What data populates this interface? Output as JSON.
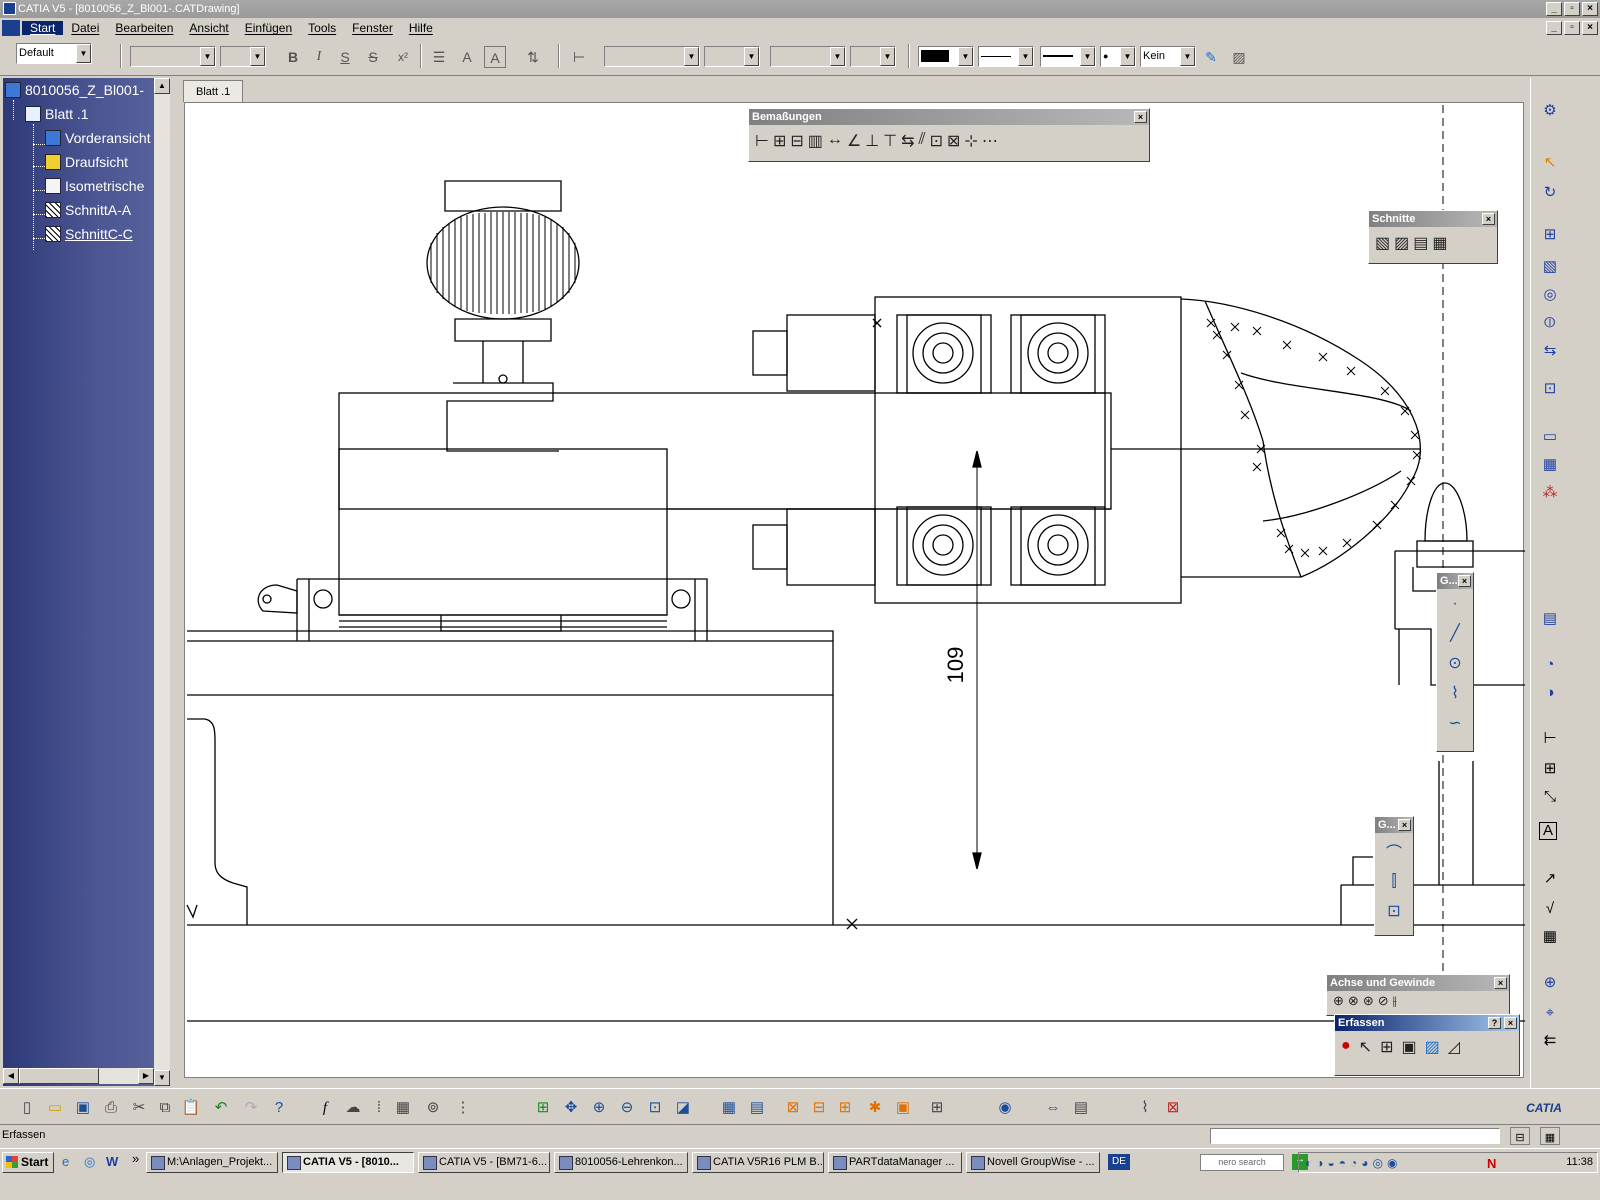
{
  "window": {
    "title": "CATIA V5 - [8010056_Z_Bl001-.CATDrawing]",
    "controls": [
      "_",
      "▫",
      "×"
    ]
  },
  "menu": {
    "items": [
      "Start",
      "Datei",
      "Bearbeiten",
      "Ansicht",
      "Einfügen",
      "Tools",
      "Fenster",
      "Hilfe"
    ]
  },
  "toolbar": {
    "style_value": "Default",
    "line_width_value": "Kein",
    "text_buttons": {
      "bold": "B",
      "italic": "I",
      "underline": "S",
      "strike": "S",
      "super": "x²"
    }
  },
  "tree": {
    "root": "8010056_Z_Bl001-",
    "sheet": "Blatt .1",
    "views": [
      "Vorderansicht",
      "Draufsicht",
      "Isometrische",
      "SchnittA-A",
      "SchnittC-C"
    ]
  },
  "sheet_tab": "Blatt .1",
  "drawing": {
    "dimension_value": "109"
  },
  "floating_toolbars": {
    "bemassungen": "Bemaßungen",
    "schnitte": "Schnitte",
    "geometry1": "G...",
    "geometry2": "G...",
    "achse": "Achse und Gewinde",
    "erfassen": "Erfassen",
    "erfassen_help": "?",
    "close": "×"
  },
  "status": {
    "text": "Erfassen"
  },
  "taskbar": {
    "start": "Start",
    "tasks": [
      "M:\\Anlagen_Projekt...",
      "CATIA V5 - [8010...",
      "CATIA V5 - [BM71-6...",
      "8010056-Lehrenkon...",
      "CATIA V5R16 PLM B...",
      "PARTdataManager ...",
      "Novell GroupWise - ..."
    ],
    "language": "DE",
    "search_label": "nero search",
    "clock": "11:38"
  },
  "brand": {
    "logo_text": "CATIA",
    "accent": "#0a246a"
  }
}
